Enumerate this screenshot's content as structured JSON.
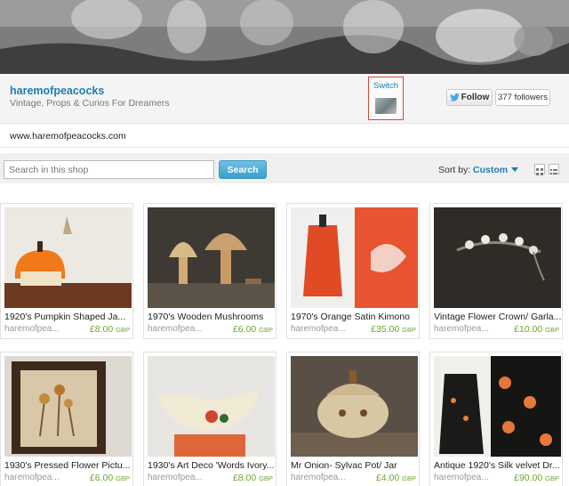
{
  "shop": {
    "name": "haremofpeacocks",
    "tagline": "Vintage, Props & Curios For Dreamers",
    "url": "www.haremofpeacocks.com",
    "switch_label": "Switch",
    "follow_label": "Follow",
    "followers_label": "377 followers"
  },
  "search": {
    "placeholder": "Search in this shop",
    "button_label": "Search",
    "sort_label": "Sort by:",
    "sort_value": "Custom"
  },
  "colors": {
    "link": "#1c7db0",
    "price": "#6aa82d",
    "accent_border": "#d64a2f"
  },
  "listings": [
    {
      "title": "1920's Pumpkin Shaped Ja...",
      "shop": "haremofpea...",
      "price": "£8.00",
      "currency": "GBP"
    },
    {
      "title": "1970's Wooden Mushrooms",
      "shop": "haremofpea...",
      "price": "£6.00",
      "currency": "GBP"
    },
    {
      "title": "1970's Orange Satin Kimono",
      "shop": "haremofpea...",
      "price": "£35.00",
      "currency": "GBP"
    },
    {
      "title": "Vintage Flower Crown/ Garla...",
      "shop": "haremofpea...",
      "price": "£10.00",
      "currency": "GBP"
    },
    {
      "title": "1930's Pressed Flower Pictu...",
      "shop": "haremofpea...",
      "price": "£6.00",
      "currency": "GBP"
    },
    {
      "title": "1930's Art Deco 'Words Ivory...",
      "shop": "haremofpea...",
      "price": "£8.00",
      "currency": "GBP"
    },
    {
      "title": "Mr Onion- Sylvac Pot/ Jar",
      "shop": "haremofpea...",
      "price": "£4.00",
      "currency": "GBP"
    },
    {
      "title": "Antique 1920's Silk velvet Dr...",
      "shop": "haremofpea...",
      "price": "£90.00",
      "currency": "GBP"
    }
  ]
}
